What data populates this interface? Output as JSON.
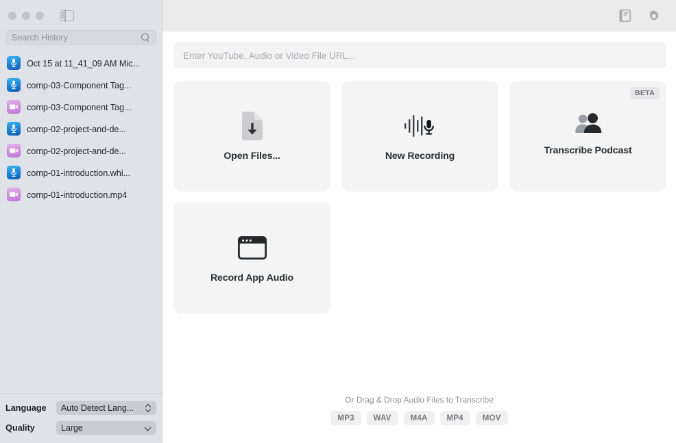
{
  "window": {
    "traffic_lights": [
      "close",
      "minimize",
      "zoom"
    ],
    "sidebar_toggle_icon": "sidebar-toggle-icon"
  },
  "sidebar": {
    "search": {
      "placeholder": "Search History",
      "value": "",
      "icon": "search-icon"
    },
    "history": [
      {
        "label": "Oct 15 at 11_41_09 AM Mic...",
        "type": "audio",
        "icon": "microphone-file-icon"
      },
      {
        "label": "comp-03-Component Tag...",
        "type": "audio",
        "icon": "microphone-file-icon"
      },
      {
        "label": "comp-03-Component Tag...",
        "type": "video",
        "icon": "video-file-icon"
      },
      {
        "label": "comp-02-project-and-de...",
        "type": "audio",
        "icon": "microphone-file-icon"
      },
      {
        "label": "comp-02-project-and-de...",
        "type": "video",
        "icon": "video-file-icon"
      },
      {
        "label": "comp-01-introduction.whi...",
        "type": "audio",
        "icon": "microphone-file-icon"
      },
      {
        "label": "comp-01-introduction.mp4",
        "type": "video",
        "icon": "video-file-icon"
      }
    ],
    "footer": {
      "language_label": "Language",
      "language_value": "Auto Detect Lang...",
      "quality_label": "Quality",
      "quality_value": "Large"
    }
  },
  "toolbar": {
    "library_icon": "book-icon",
    "settings_icon": "gear-icon"
  },
  "main": {
    "url_input": {
      "placeholder": "Enter YouTube, Audio or Video File URL...",
      "value": ""
    },
    "cards": [
      {
        "label": "Open Files...",
        "icon": "document-download-icon",
        "badge": ""
      },
      {
        "label": "New Recording",
        "icon": "waveform-microphone-icon",
        "badge": ""
      },
      {
        "label": "Transcribe Podcast",
        "icon": "two-people-icon",
        "badge": "BETA"
      },
      {
        "label": "Record App Audio",
        "icon": "app-window-icon",
        "badge": ""
      }
    ],
    "drop_hint": "Or Drag & Drop Audio Files to Transcribe",
    "formats": [
      "MP3",
      "WAV",
      "M4A",
      "MP4",
      "MOV"
    ]
  },
  "colors": {
    "sidebar_bg": "#dfe3e8",
    "toolbar_bg": "#ebebeb",
    "card_bg": "#f4f4f5",
    "audio_icon": "#1f86d8",
    "video_icon": "#d18ce0",
    "text_primary": "#2a2d31",
    "text_muted": "#8d9095"
  }
}
